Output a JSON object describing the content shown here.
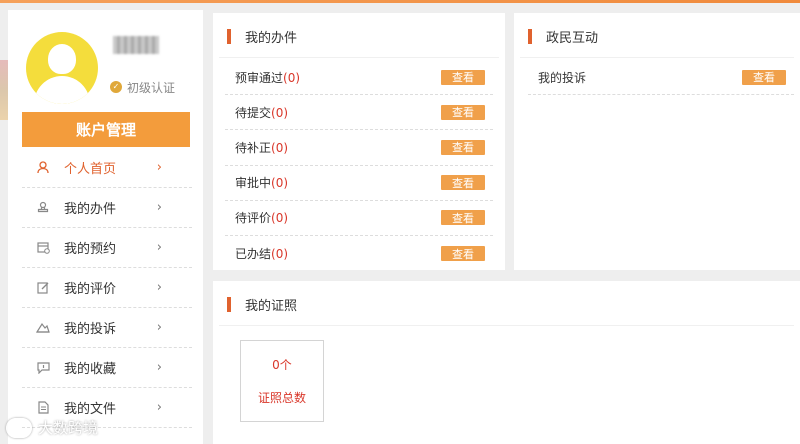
{
  "user": {
    "name": "▒▒▒",
    "verification": "初级认证"
  },
  "sidebar": {
    "account_button": "账户管理",
    "items": [
      {
        "label": "个人首页",
        "icon": "person-icon",
        "active": true
      },
      {
        "label": "我的办件",
        "icon": "stamp-icon",
        "active": false
      },
      {
        "label": "我的预约",
        "icon": "calendar-icon",
        "active": false
      },
      {
        "label": "我的评价",
        "icon": "edit-icon",
        "active": false
      },
      {
        "label": "我的投诉",
        "icon": "complaint-icon",
        "active": false
      },
      {
        "label": "我的收藏",
        "icon": "bookmark-icon",
        "active": false
      },
      {
        "label": "我的文件",
        "icon": "document-icon",
        "active": false
      }
    ]
  },
  "my_cases": {
    "title": "我的办件",
    "rows": [
      {
        "label": "预审通过",
        "count": "(0)",
        "action": "查看"
      },
      {
        "label": "待提交",
        "count": "(0)",
        "action": "查看"
      },
      {
        "label": "待补正",
        "count": "(0)",
        "action": "查看"
      },
      {
        "label": "审批中",
        "count": "(0)",
        "action": "查看"
      },
      {
        "label": "待评价",
        "count": "(0)",
        "action": "查看"
      },
      {
        "label": "已办结",
        "count": "(0)",
        "action": "查看"
      }
    ]
  },
  "interaction": {
    "title": "政民互动",
    "rows": [
      {
        "label": "我的投诉",
        "action": "查看"
      }
    ]
  },
  "licenses": {
    "title": "我的证照",
    "count": "0个",
    "count_label": "证照总数"
  },
  "watermark": "大数跨境",
  "colors": {
    "accent": "#f39c3c",
    "active": "#e0622e",
    "count_red": "#d9372a",
    "avatar_yellow": "#f4dd3c"
  }
}
